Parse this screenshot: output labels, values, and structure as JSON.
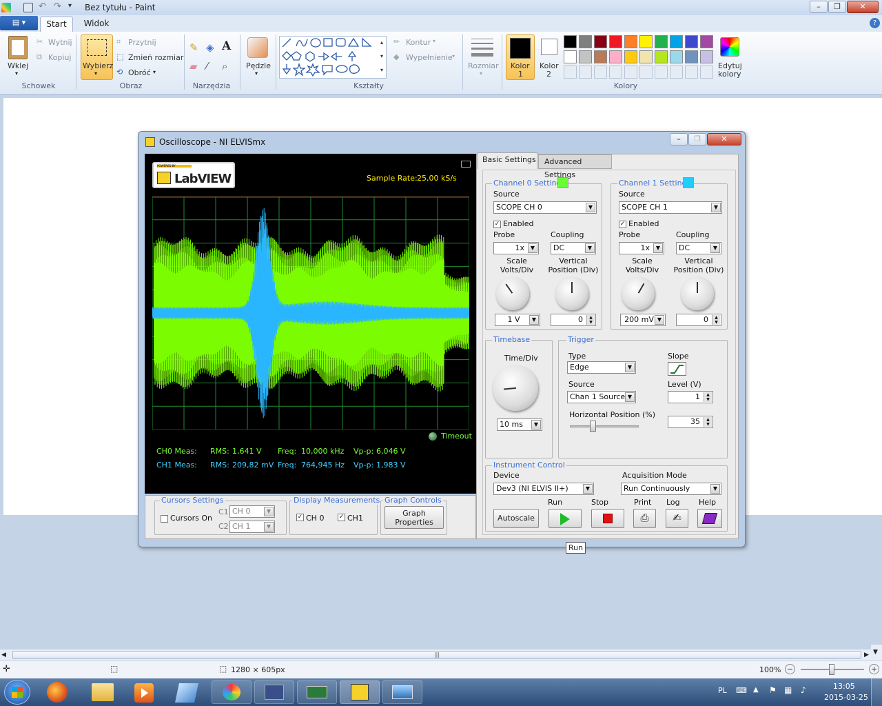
{
  "paint": {
    "title": "Bez tytułu - Paint",
    "tabs": [
      "Start",
      "Widok"
    ],
    "clipboard": {
      "paste": "Wklej",
      "cut": "Wytnij",
      "copy": "Kopiuj",
      "group": "Schowek"
    },
    "image": {
      "select": "Wybierz",
      "crop": "Przytnij",
      "resize": "Zmień rozmiar",
      "rotate": "Obróć",
      "group": "Obraz"
    },
    "tools": {
      "group": "Narzędzia"
    },
    "brushes": {
      "label": "Pędzle"
    },
    "shapes": {
      "outline": "Kontur",
      "fill": "Wypełnienie",
      "group": "Kształty"
    },
    "size": {
      "label": "Rozmiar"
    },
    "colors": {
      "color1": "Kolor",
      "color1_num": "1",
      "color2": "Kolor",
      "color2_num": "2",
      "edit": "Edytuj",
      "edit2": "kolory",
      "group": "Kolory",
      "palette_row1": [
        "#000000",
        "#7f7f7f",
        "#880015",
        "#ed1c24",
        "#ff7f27",
        "#fff200",
        "#22b14c",
        "#00a2e8",
        "#3f48cc",
        "#a349a4"
      ],
      "palette_row2": [
        "#ffffff",
        "#c3c3c3",
        "#b97a57",
        "#ffaec9",
        "#ffc90e",
        "#efe4b0",
        "#b5e61d",
        "#99d9ea",
        "#7092be",
        "#c8bfe7"
      ]
    },
    "status": {
      "dimensions": "1280 × 605px",
      "zoom": "100%"
    }
  },
  "osc": {
    "title": "Oscilloscope - NI ELVISmx",
    "logo": "LabVIEW",
    "logo_small": "POWERED BY",
    "sample_rate_label": "Sample Rate:",
    "sample_rate": "25,00 kS/s",
    "timeout": "Timeout",
    "ch0": {
      "label": "CH0 Meas:",
      "rms_label": "RMS:",
      "rms": "1,641 V",
      "freq_label": "Freq:",
      "freq": "10,000 kHz",
      "vpp_label": "Vp-p:",
      "vpp": "6,046 V"
    },
    "ch1": {
      "label": "CH1 Meas:",
      "rms_label": "RMS:",
      "rms": "209,82 mV",
      "freq_label": "Freq:",
      "freq": "764,945 Hz",
      "vpp_label": "Vp-p:",
      "vpp": "1,983 V"
    },
    "cursors": {
      "group": "Cursors Settings",
      "on": "Cursors On",
      "c1": "C1",
      "c1_val": "CH 0",
      "c2": "C2",
      "c2_val": "CH 1"
    },
    "display": {
      "group": "Display Measurements",
      "ch0": "CH 0",
      "ch1": "CH1"
    },
    "graph": {
      "group": "Graph Controls",
      "btn1": "Graph",
      "btn2": "Properties"
    },
    "tabs": {
      "basic": "Basic Settings",
      "advanced": "Advanced Settings"
    },
    "c0": {
      "title": "Channel 0 Settings",
      "color": "#66ff33",
      "source_label": "Source",
      "source": "SCOPE CH 0",
      "enabled": "Enabled",
      "probe_label": "Probe",
      "probe": "1x",
      "coupling_label": "Coupling",
      "coupling": "DC",
      "scale1": "Scale",
      "scale2": "Volts/Div",
      "vert1": "Vertical",
      "vert2": "Position (Div)",
      "scale_val": "1 V",
      "vert_val": "0"
    },
    "c1": {
      "title": "Channel 1 Settings",
      "color": "#22ccff",
      "source_label": "Source",
      "source": "SCOPE CH 1",
      "enabled": "Enabled",
      "probe_label": "Probe",
      "probe": "1x",
      "coupling_label": "Coupling",
      "coupling": "DC",
      "scale1": "Scale",
      "scale2": "Volts/Div",
      "vert1": "Vertical",
      "vert2": "Position (Div)",
      "scale_val": "200 mV",
      "vert_val": "0"
    },
    "timebase": {
      "group": "Timebase",
      "label": "Time/Div",
      "value": "10 ms"
    },
    "trigger": {
      "group": "Trigger",
      "type_label": "Type",
      "type": "Edge",
      "slope_label": "Slope",
      "source_label": "Source",
      "source": "Chan 1 Source",
      "level_label": "Level (V)",
      "level": "1",
      "hpos_label": "Horizontal Position (%)",
      "hpos": "35"
    },
    "instrument": {
      "group": "Instrument Control",
      "device_label": "Device",
      "device": "Dev3 (NI ELVIS II+)",
      "acq_label": "Acquisition Mode",
      "acq": "Run Continuously",
      "autoscale": "Autoscale",
      "run": "Run",
      "stop": "Stop",
      "print": "Print",
      "log": "Log",
      "help": "Help"
    },
    "tooltip": "Run"
  },
  "taskbar": {
    "lang": "PL",
    "time": "13:05",
    "date": "2015-03-25"
  }
}
